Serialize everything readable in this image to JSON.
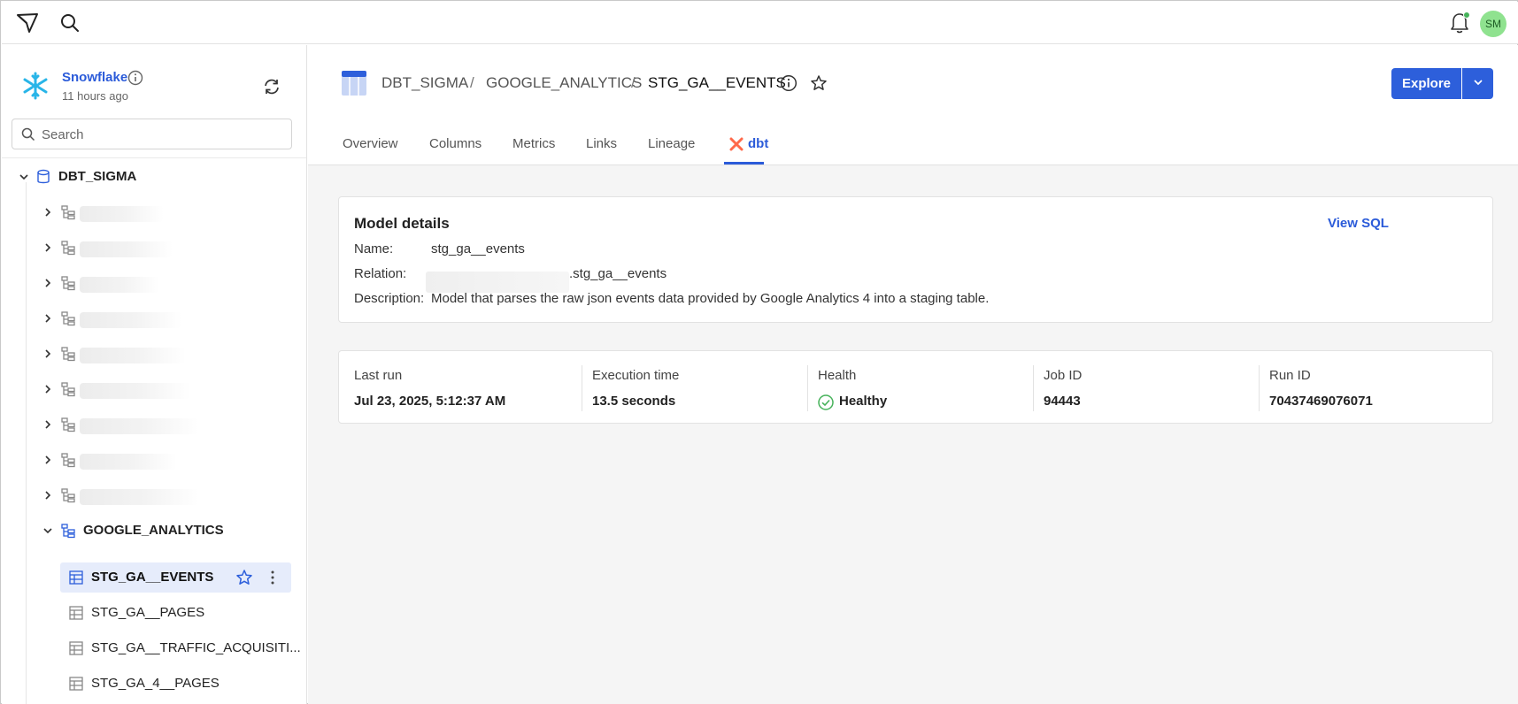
{
  "topbar": {
    "avatar_initials": "SM",
    "notification_dot_color": "#46b25a"
  },
  "sidebar": {
    "connection_name": "Snowflake",
    "connection_updated": "11 hours ago",
    "search_placeholder": "Search",
    "tree": {
      "database": "DBT_SIGMA",
      "redacted_schema_count": 9,
      "schema": "GOOGLE_ANALYTICS",
      "tables": [
        {
          "label": "STG_GA__EVENTS",
          "selected": true
        },
        {
          "label": "STG_GA__PAGES",
          "selected": false
        },
        {
          "label": "STG_GA__TRAFFIC_ACQUISITI...",
          "selected": false
        },
        {
          "label": "STG_GA_4__PAGES",
          "selected": false
        }
      ]
    }
  },
  "header": {
    "breadcrumb": [
      "DBT_SIGMA",
      "GOOGLE_ANALYTICS",
      "STG_GA__EVENTS"
    ],
    "breadcrumb_sep": "/",
    "explore_label": "Explore",
    "tabs": [
      "Overview",
      "Columns",
      "Metrics",
      "Links",
      "Lineage",
      "dbt"
    ],
    "active_tab": "dbt"
  },
  "model_details": {
    "title": "Model details",
    "view_sql_label": "View SQL",
    "name_key": "Name:",
    "name_value": "stg_ga__events",
    "relation_key": "Relation:",
    "relation_value": ".stg_ga__events",
    "description_key": "Description:",
    "description_value": "Model that parses the raw json events data provided by Google Analytics 4 into a staging table."
  },
  "run_stats": {
    "last_run_label": "Last run",
    "last_run_value": "Jul 23, 2025, 5:12:37 AM",
    "execution_label": "Execution time",
    "execution_value": "13.5 seconds",
    "health_label": "Health",
    "health_value": "Healthy",
    "job_id_label": "Job ID",
    "job_id_value": "94443",
    "run_id_label": "Run ID",
    "run_id_value": "70437469076071"
  },
  "colors": {
    "accent": "#2d5fdb",
    "selected_row": "#e6ecfb",
    "healthy": "#46b25a"
  }
}
